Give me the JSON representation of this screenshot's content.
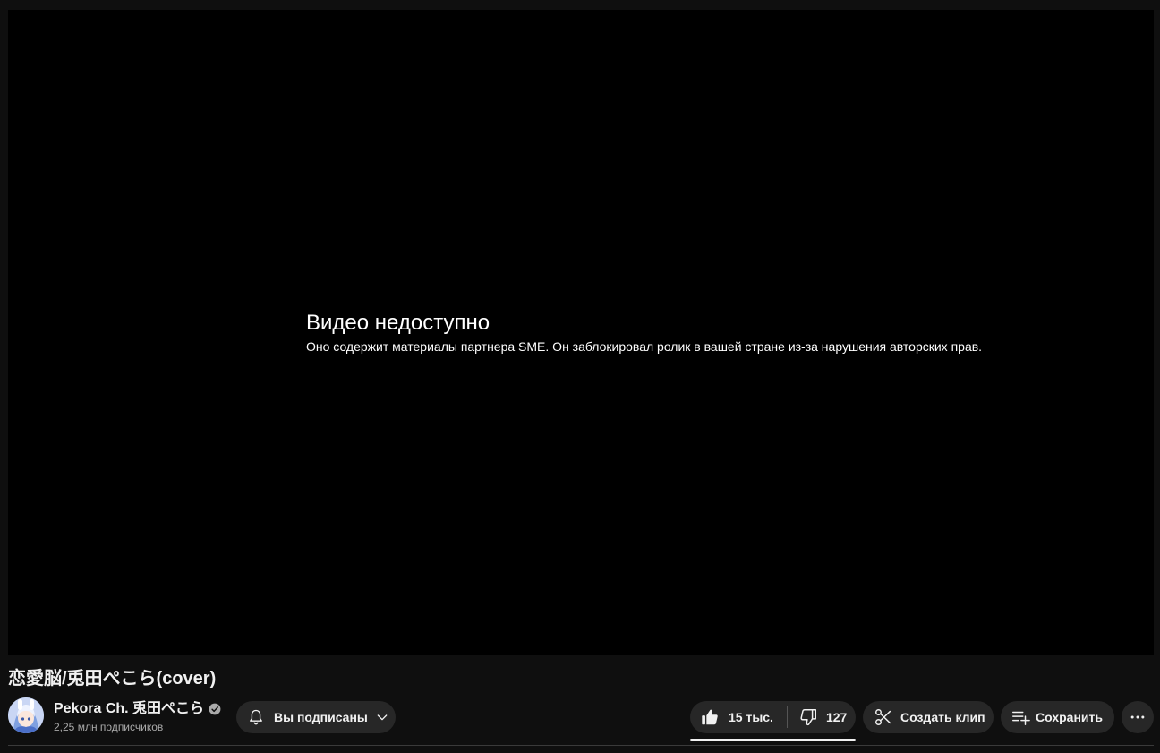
{
  "player": {
    "error_title": "Видео недоступно",
    "error_message": "Оно содержит материалы партнера SME. Он заблокировал ролик в вашей стране из-за нарушения авторских прав."
  },
  "video": {
    "title": "恋愛脳/兎田ぺこら(cover)"
  },
  "channel": {
    "name": "Pekora Ch. 兎田ぺこら",
    "subscribers": "2,25 млн подписчиков",
    "subscribe_label": "Вы подписаны"
  },
  "actions": {
    "likes": "15 тыс.",
    "dislikes": "127",
    "clip_label": "Создать клип",
    "save_label": "Сохранить"
  },
  "colors": {
    "background": "#0f0f0f",
    "player": "#000000",
    "pill": "#272727",
    "text": "#f1f1f1",
    "secondary_text": "#aaaaaa"
  }
}
